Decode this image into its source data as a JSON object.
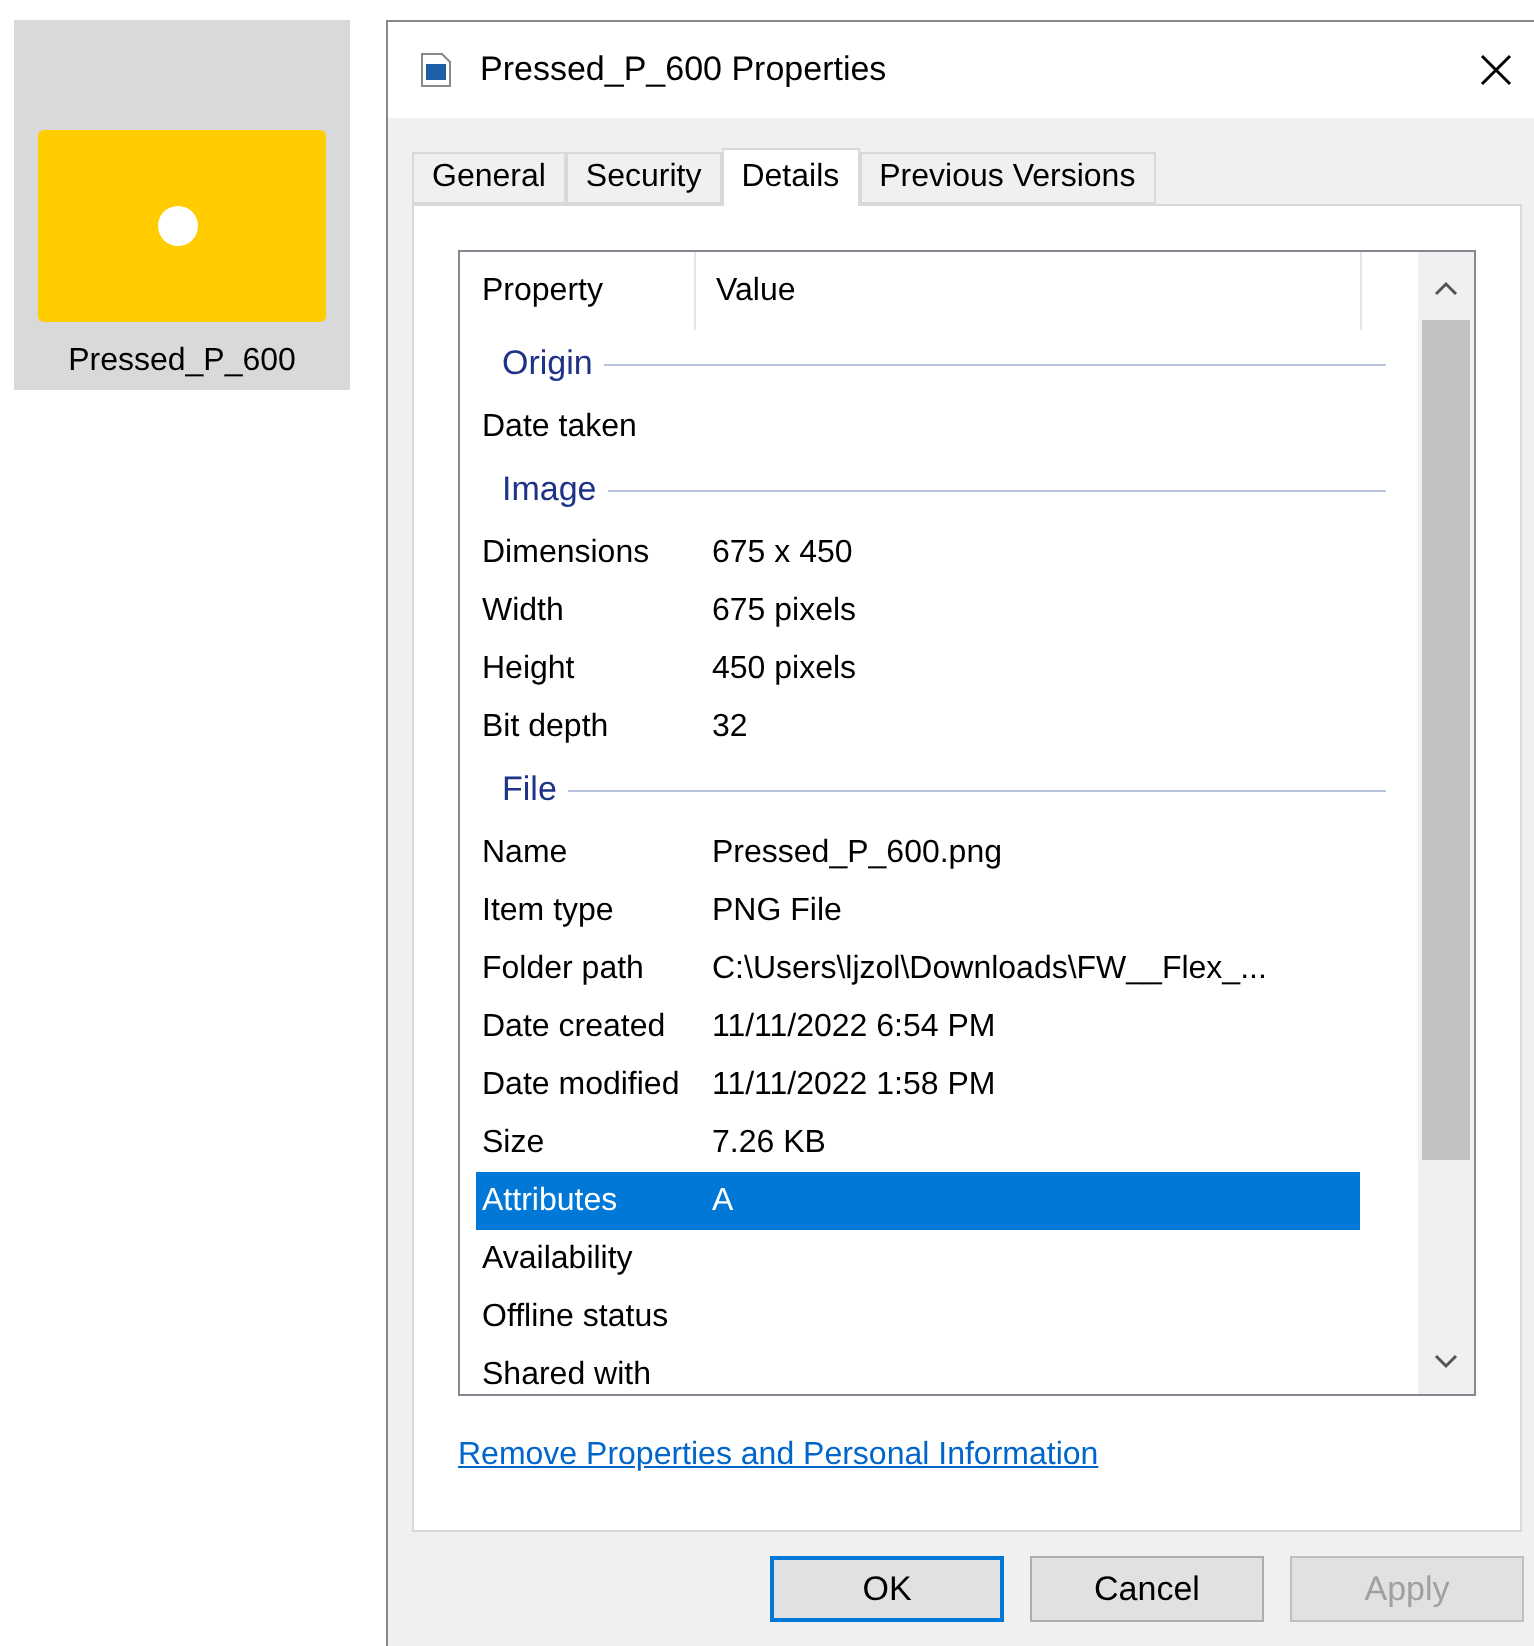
{
  "desktop_icon": {
    "label": "Pressed_P_600",
    "selected": true
  },
  "window": {
    "title": "Pressed_P_600 Properties"
  },
  "tabs": [
    {
      "label": "General",
      "selected": false
    },
    {
      "label": "Security",
      "selected": false
    },
    {
      "label": "Details",
      "selected": true
    },
    {
      "label": "Previous Versions",
      "selected": false
    }
  ],
  "table": {
    "columns": [
      "Property",
      "Value"
    ],
    "rows": [
      {
        "kind": "group",
        "label": "Origin"
      },
      {
        "kind": "property",
        "property": "Date taken",
        "value": "",
        "selected": false
      },
      {
        "kind": "group",
        "label": "Image"
      },
      {
        "kind": "property",
        "property": "Dimensions",
        "value": "675 x 450",
        "selected": false
      },
      {
        "kind": "property",
        "property": "Width",
        "value": "675 pixels",
        "selected": false
      },
      {
        "kind": "property",
        "property": "Height",
        "value": "450 pixels",
        "selected": false
      },
      {
        "kind": "property",
        "property": "Bit depth",
        "value": "32",
        "selected": false
      },
      {
        "kind": "group",
        "label": "File"
      },
      {
        "kind": "property",
        "property": "Name",
        "value": "Pressed_P_600.png",
        "selected": false
      },
      {
        "kind": "property",
        "property": "Item type",
        "value": "PNG File",
        "selected": false
      },
      {
        "kind": "property",
        "property": "Folder path",
        "value": "C:\\Users\\ljzol\\Downloads\\FW__Flex_...",
        "selected": false
      },
      {
        "kind": "property",
        "property": "Date created",
        "value": "11/11/2022 6:54 PM",
        "selected": false
      },
      {
        "kind": "property",
        "property": "Date modified",
        "value": "11/11/2022 1:58 PM",
        "selected": false
      },
      {
        "kind": "property",
        "property": "Size",
        "value": "7.26 KB",
        "selected": false
      },
      {
        "kind": "property",
        "property": "Attributes",
        "value": "A",
        "selected": true
      },
      {
        "kind": "property",
        "property": "Availability",
        "value": "",
        "selected": false
      },
      {
        "kind": "property",
        "property": "Offline status",
        "value": "",
        "selected": false
      },
      {
        "kind": "property",
        "property": "Shared with",
        "value": "",
        "selected": false
      }
    ]
  },
  "link": "Remove Properties and Personal Information",
  "buttons": [
    {
      "label": "OK",
      "default": true,
      "disabled": false
    },
    {
      "label": "Cancel",
      "default": false,
      "disabled": false
    },
    {
      "label": "Apply",
      "default": false,
      "disabled": true
    }
  ]
}
